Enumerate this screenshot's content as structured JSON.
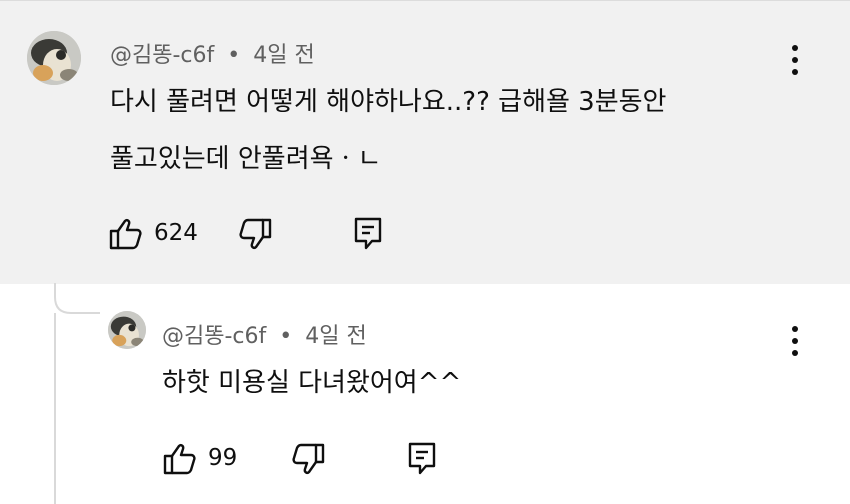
{
  "comment": {
    "author": "@김똥-c6f",
    "separator": "•",
    "time": "4일 전",
    "line1": "다시 풀려면 어떻게 해야하나요..?? 급해욜 3분동안",
    "line2": "풀고있는데 안풀려욕ㆍㄴ",
    "likes": "624"
  },
  "reply": {
    "author": "@김똥-c6f",
    "separator": "•",
    "time": "4일 전",
    "text": "하핫 미용실 다녀왔어여^^",
    "likes": "99"
  },
  "icons": {
    "like": "thumbs-up-icon",
    "dislike": "thumbs-down-icon",
    "reply": "reply-icon",
    "more": "more-vertical-icon"
  },
  "colors": {
    "highlight_bg": "#f1f1f1",
    "meta_text": "#606060",
    "thread_line": "#d9d9d9"
  }
}
